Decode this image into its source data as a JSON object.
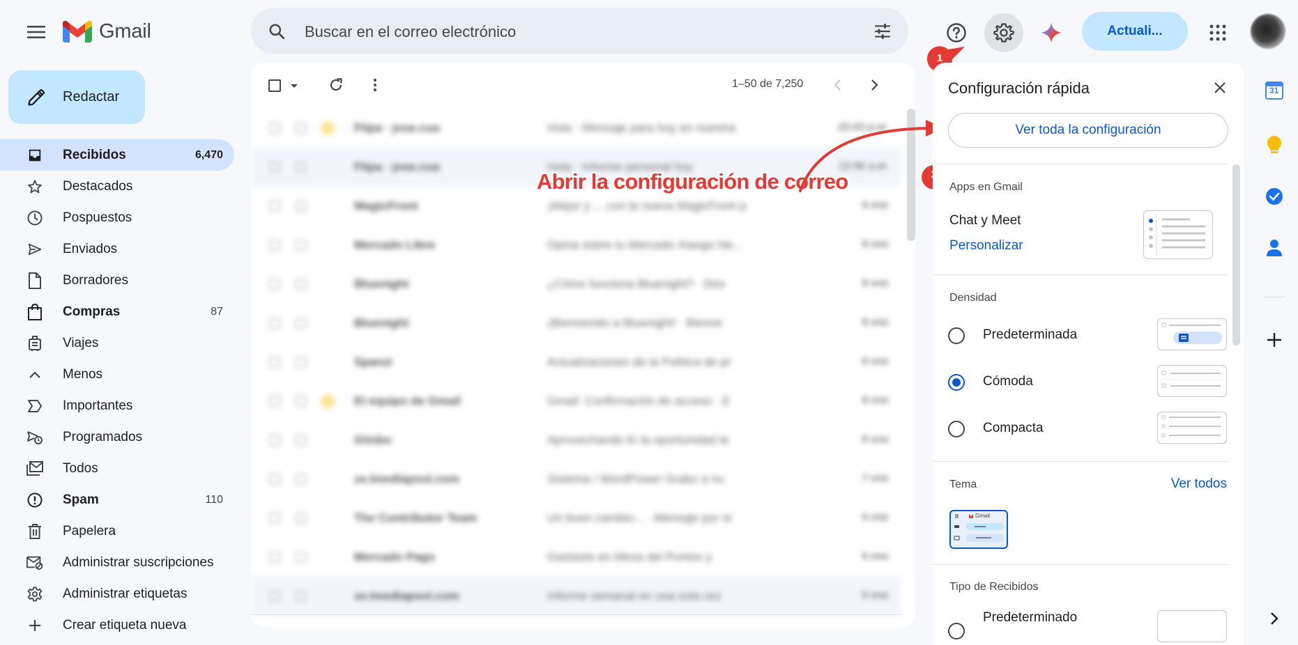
{
  "header": {
    "logo_text": "Gmail",
    "search_placeholder": "Buscar en el correo electrónico",
    "upgrade_label": "Actuali..."
  },
  "nav": {
    "compose_label": "Redactar",
    "items": [
      {
        "label": "Recibidos",
        "count": "6,470",
        "icon": "inbox-icon",
        "bold": true,
        "active": true
      },
      {
        "label": "Destacados",
        "count": "",
        "icon": "star-icon"
      },
      {
        "label": "Pospuestos",
        "count": "",
        "icon": "clock-icon"
      },
      {
        "label": "Enviados",
        "count": "",
        "icon": "send-icon"
      },
      {
        "label": "Borradores",
        "count": "",
        "icon": "draft-icon"
      },
      {
        "label": "Compras",
        "count": "87",
        "icon": "shopping-bag-icon",
        "bold": true
      },
      {
        "label": "Viajes",
        "count": "",
        "icon": "luggage-icon"
      },
      {
        "label": "Menos",
        "count": "",
        "icon": "chevron-up-icon"
      },
      {
        "label": "Importantes",
        "count": "",
        "icon": "label-important-icon"
      },
      {
        "label": "Programados",
        "count": "",
        "icon": "scheduled-send-icon"
      },
      {
        "label": "Todos",
        "count": "",
        "icon": "all-mail-icon"
      },
      {
        "label": "Spam",
        "count": "110",
        "icon": "spam-icon",
        "bold": true
      },
      {
        "label": "Papelera",
        "count": "",
        "icon": "trash-icon"
      },
      {
        "label": "Administrar suscripciones",
        "count": "",
        "icon": "unsubscribe-icon"
      },
      {
        "label": "Administrar etiquetas",
        "count": "",
        "icon": "gear-icon"
      },
      {
        "label": "Crear etiqueta nueva",
        "count": "",
        "icon": "plus-icon"
      }
    ]
  },
  "list": {
    "pager": "1–50 de 7,250",
    "rows": [
      {
        "sender": "Flipa · jose.cuo",
        "subject": "Hola · Mensaje para hoy en nuestra",
        "date": "15:03 p.m.",
        "important": true
      },
      {
        "sender": "Flipa · jose.cuo",
        "subject": "Hola · Informe personal hoy",
        "date": "13:56 a.m.",
        "alt": true
      },
      {
        "sender": "MagicFront",
        "subject": "¡Mejor y ... con la nueva MagicFront p",
        "date": "9 ene"
      },
      {
        "sender": "Mercado Libre",
        "subject": "Opina sobre tu Mercado Xiaogo Ne...",
        "date": "8 ene"
      },
      {
        "sender": "Bluenight",
        "subject": "¿Cómo funciona Bluenight? · Des",
        "date": "8 ene"
      },
      {
        "sender": "Bluenight",
        "subject": "¡Bienvenido a Bluenight! · Bienve",
        "date": "8 ene"
      },
      {
        "sender": "Spanzi",
        "subject": "Actualizaciones de la Política de pr",
        "date": "8 ene"
      },
      {
        "sender": "El equipo de Gmail",
        "subject": "Gmail: Confirmación de acceso · E",
        "date": "8 ene",
        "important": true
      },
      {
        "sender": "Gimbo",
        "subject": "Aprovechando Ki la oportunidad te",
        "date": "8 ene"
      },
      {
        "sender": "ze.lmediapsol.com",
        "subject": "Sistema / WordPower Grabo a nu",
        "date": "7 ene"
      },
      {
        "sender": "The Contributor Team",
        "subject": "Un buen cambio... · Mensaje por el",
        "date": "6 ene"
      },
      {
        "sender": "Mercado Pago",
        "subject": "Gastaste en Mesa del Puntos y",
        "date": "6 ene"
      },
      {
        "sender": "ze.lmediapsol.com",
        "subject": "Informe semanal en una sola vez",
        "date": "5 ene",
        "alt": true
      }
    ]
  },
  "annotation": {
    "text": "Abrir la configuración de correo",
    "step1": "1",
    "step2": "2",
    "color": "#e53935"
  },
  "quick_settings": {
    "title": "Configuración rápida",
    "see_all": "Ver toda la configuración",
    "apps_section": "Apps en Gmail",
    "chat_meet": "Chat y Meet",
    "customize": "Personalizar",
    "density_section": "Densidad",
    "density_options": [
      {
        "label": "Predeterminada",
        "selected": false
      },
      {
        "label": "Cómoda",
        "selected": true
      },
      {
        "label": "Compacta",
        "selected": false
      }
    ],
    "theme_section": "Tema",
    "theme_see_all": "Ver todos",
    "theme_thumb_logo": "Gmail",
    "inbox_type_section": "Tipo de Recibidos",
    "inbox_type_option": "Predeterminado"
  },
  "rail": {
    "calendar_day": "31"
  },
  "colors": {
    "accent": "#0b57d0",
    "compose_bg": "#c2e7ff",
    "active_nav": "#d3e3fd",
    "background": "#f6f8fc"
  }
}
